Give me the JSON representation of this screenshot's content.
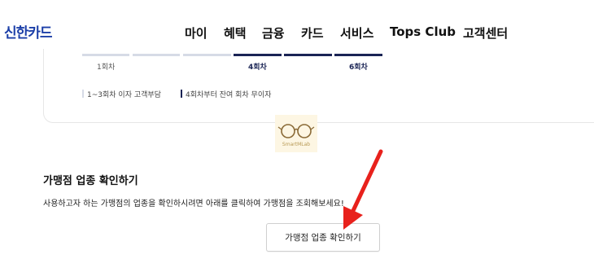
{
  "header": {
    "logo": "신한카드",
    "nav": [
      {
        "label": "마이",
        "active": false
      },
      {
        "label": "혜택",
        "active": true
      },
      {
        "label": "금융",
        "active": false
      },
      {
        "label": "카드",
        "active": false
      },
      {
        "label": "서비스",
        "active": false
      },
      {
        "label": "Tops Club",
        "active": false
      },
      {
        "label": "고객센터",
        "active": false
      }
    ]
  },
  "installments": {
    "steps": [
      "1회차",
      "4회차",
      "6회차"
    ],
    "legend": [
      "1~3회차 이자 고객부담",
      "4회차부터 잔여 회차 무이자"
    ],
    "colors": {
      "customer": "#d6dbe6",
      "free": "#1a2455"
    }
  },
  "watermark": {
    "text": "SmartMLab"
  },
  "merchant_check": {
    "title": "가맹점 업종 확인하기",
    "description": "사용하고자 하는 가맹점의 업종을 확인하시려면 아래를 클릭하여 가맹점을 조회해보세요!",
    "button": "가맹점 업종 확인하기"
  },
  "annotation": {
    "arrow_color": "#e8211c"
  }
}
